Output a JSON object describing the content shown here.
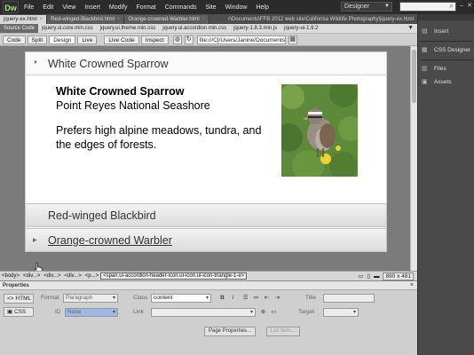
{
  "app": {
    "logo": "Dw",
    "menu": [
      "File",
      "Edit",
      "View",
      "Insert",
      "Modify",
      "Format",
      "Commands",
      "Site",
      "Window",
      "Help"
    ],
    "workspace": "Designer"
  },
  "doc_tabs": [
    {
      "label": "jquery-ex.html",
      "active": true
    },
    {
      "label": "Red-winged-Blackbird.html",
      "active": false
    },
    {
      "label": "Orange-crowned-Warbler.html",
      "active": false
    }
  ],
  "doc_path": "r\\Documents\\FFB 2012 web site\\California Wildlife Photography\\jquery-ex.html",
  "related_files": [
    "Source Code",
    "jquery.ui.core.min.css",
    "jquery.ui.theme.min.css",
    "jquery.ui.accordion.min.css",
    "jquery-1.8.3.min.js",
    "jquery-ui-1.9.2"
  ],
  "view_toolbar": {
    "buttons": [
      "Code",
      "Split",
      "Design",
      "Live",
      "Live Code",
      "Inspect"
    ],
    "address": "file:///C|/Users/Janine/Documents/Bi"
  },
  "accordion": {
    "open_header": "White Crowned Sparrow",
    "content": {
      "title": "White Crowned Sparrow",
      "subtitle": "Point Reyes National Seashore",
      "description": "Prefers high alpine meadows, tundra, and the edges of forests."
    },
    "collapsed_headers": [
      "Red-winged Blackbird",
      "Orange-crowned Warbler"
    ]
  },
  "tag_selector": {
    "tags": [
      "<body>",
      "<div...>",
      "<div...>",
      "<div...>",
      "<p...>"
    ],
    "selected_tag": "<span.ui-accordion-header-icon.ui-icon.ui-icon-triangle-1-e>",
    "dimensions": "890 x 481"
  },
  "properties": {
    "title": "Properties",
    "html_mode": "HTML",
    "css_mode": "CSS",
    "format_label": "Format",
    "format_value": "Paragraph",
    "class_label": "Class",
    "class_value": "content",
    "id_label": "ID",
    "id_value": "None",
    "link_label": "Link",
    "title_label": "Title",
    "target_label": "Target",
    "page_properties": "Page Properties...",
    "list_item": "List Item..."
  },
  "right_dock": {
    "items": [
      "Insert",
      "CSS Designer",
      "Files",
      "Assets"
    ]
  },
  "colors": {
    "menubar": "#2b2b2b",
    "canvas_bg": "#7b7b7b",
    "accordion_content": "#ffffff",
    "id_select": "#9fb7e4"
  }
}
